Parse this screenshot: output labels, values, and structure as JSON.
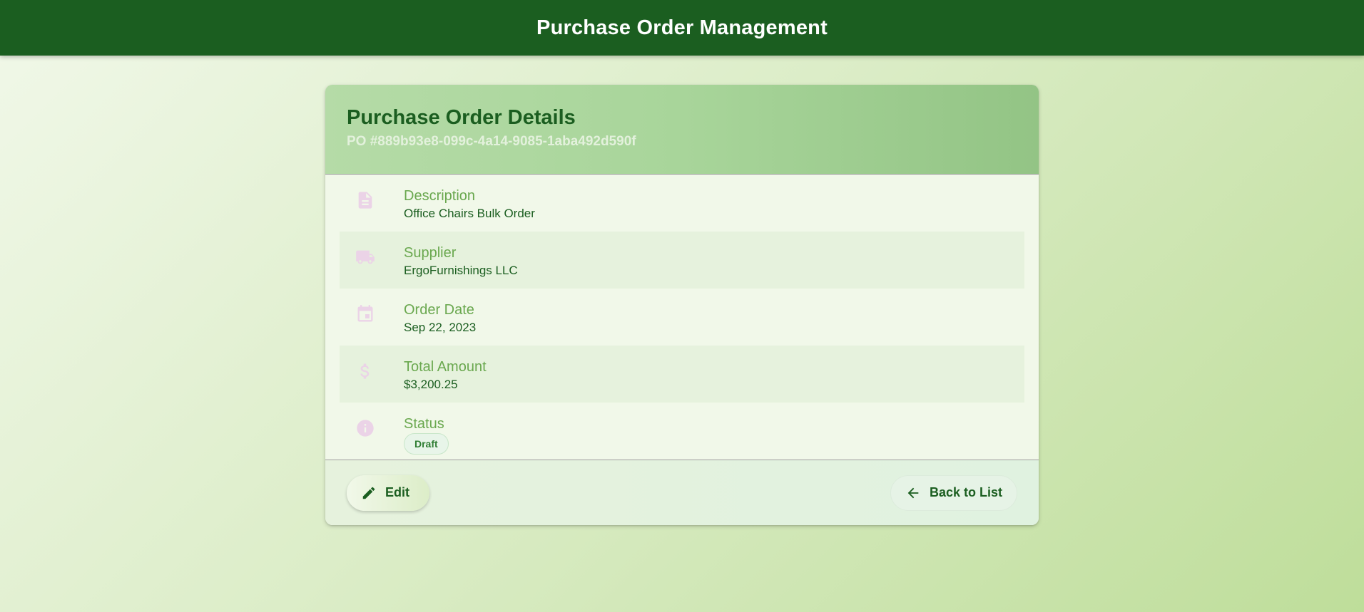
{
  "app_bar": {
    "title": "Purchase Order Management"
  },
  "card": {
    "title": "Purchase Order Details",
    "po_number": "PO #889b93e8-099c-4a14-9085-1aba492d590f",
    "details": {
      "description": {
        "icon": "document-icon",
        "label": "Description",
        "value": "Office Chairs Bulk Order"
      },
      "supplier": {
        "icon": "truck-icon",
        "label": "Supplier",
        "value": "ErgoFurnishings LLC"
      },
      "order_date": {
        "icon": "calendar-icon",
        "label": "Order Date",
        "value": "Sep 22, 2023"
      },
      "total_amount": {
        "icon": "dollar-icon",
        "label": "Total Amount",
        "value": "$3,200.25"
      },
      "status": {
        "icon": "info-icon",
        "label": "Status",
        "value": "Draft"
      }
    },
    "actions": {
      "edit": {
        "icon": "pencil-icon",
        "label": "Edit"
      },
      "back": {
        "icon": "arrow-left-icon",
        "label": "Back to List"
      }
    }
  },
  "colors": {
    "app_bar": "#1b5e20",
    "primary_text": "#1b5e20",
    "label_text": "#6aa84f",
    "icon_tint": "#ebd3e7",
    "status_chip": "#e8f5e9"
  }
}
